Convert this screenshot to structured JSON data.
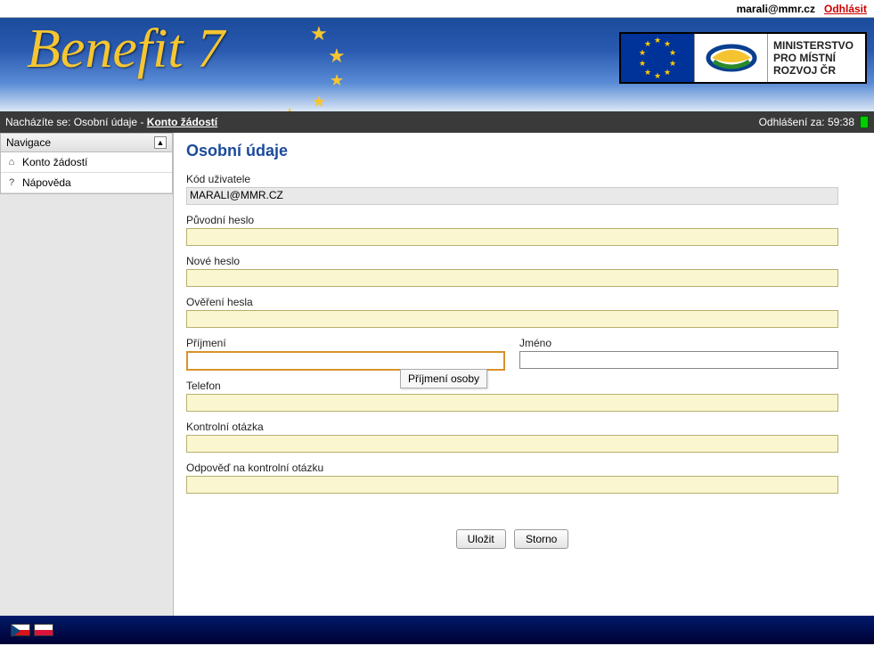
{
  "topbar": {
    "user": "marali@mmr.cz",
    "logout": "Odhlásit"
  },
  "brand": "Benefit 7",
  "ministry": {
    "line1": "MINISTERSTVO",
    "line2": "PRO MÍSTNÍ",
    "line3": "ROZVOJ ČR"
  },
  "breadcrumb": {
    "prefix": "Nacházíte se: ",
    "part1": "Osobní údaje",
    "link": "Konto žádostí"
  },
  "session": {
    "label": "Odhlášení za: ",
    "time": "59:38"
  },
  "nav": {
    "title": "Navigace",
    "items": [
      {
        "icon": "home",
        "label": "Konto žádostí"
      },
      {
        "icon": "help",
        "label": "Nápověda"
      }
    ]
  },
  "page": {
    "title": "Osobní údaje",
    "fields": {
      "userCodeLabel": "Kód uživatele",
      "userCodeValue": "MARALI@MMR.CZ",
      "origPasswordLabel": "Původní heslo",
      "newPasswordLabel": "Nové heslo",
      "confirmPasswordLabel": "Ověření hesla",
      "surnameLabel": "Příjmení",
      "firstnameLabel": "Jméno",
      "phoneLabel": "Telefon",
      "questionLabel": "Kontrolní otázka",
      "answerLabel": "Odpověď na kontrolní otázku",
      "surnameTooltip": "Příjmení osoby"
    },
    "buttons": {
      "save": "Uložit",
      "cancel": "Storno"
    }
  }
}
